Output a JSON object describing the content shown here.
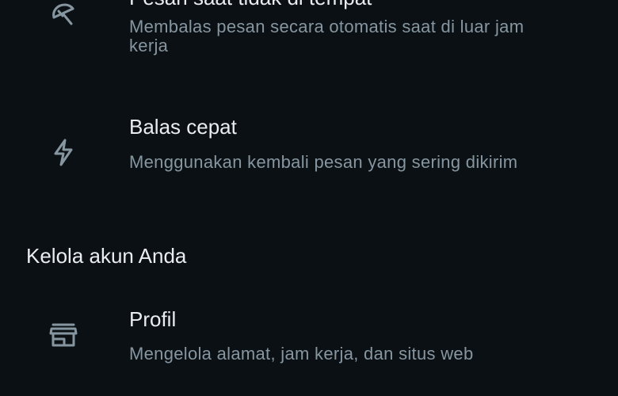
{
  "items": [
    {
      "title": "Pesan saat tidak di tempat",
      "description": "Membalas pesan secara otomatis saat di luar jam kerja",
      "icon": "umbrella-off-icon"
    },
    {
      "title": "Balas cepat",
      "description": "Menggunakan kembali pesan yang sering dikirim",
      "icon": "lightning-bolt-icon"
    },
    {
      "title": "Profil",
      "description": "Mengelola alamat, jam kerja, dan situs web",
      "icon": "storefront-icon"
    }
  ],
  "section": {
    "manage_account_label": "Kelola akun Anda"
  },
  "colors": {
    "background": "#0b1014",
    "primary_text": "#e9edef",
    "secondary_text": "#8696a0",
    "icon": "#8696a0"
  }
}
